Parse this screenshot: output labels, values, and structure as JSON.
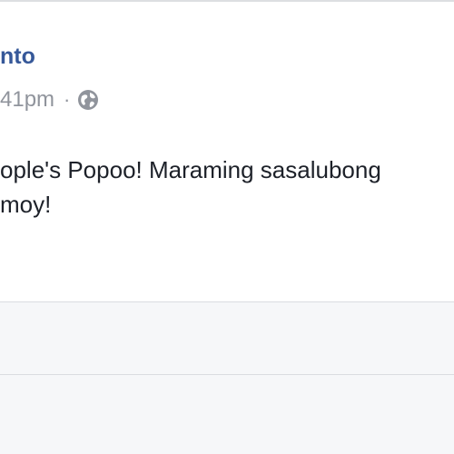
{
  "post": {
    "author_name": "nto",
    "timestamp": "41pm",
    "separator": "·",
    "privacy_icon": "globe-icon",
    "text_lines": [
      "ople's Popoo! Maraming sasalubong",
      "moy!"
    ]
  },
  "colors": {
    "author_link": "#365899",
    "meta_text": "#90949c",
    "body_text": "#1d2129",
    "footer_background": "#f6f7f9",
    "divider": "#dadde1"
  }
}
